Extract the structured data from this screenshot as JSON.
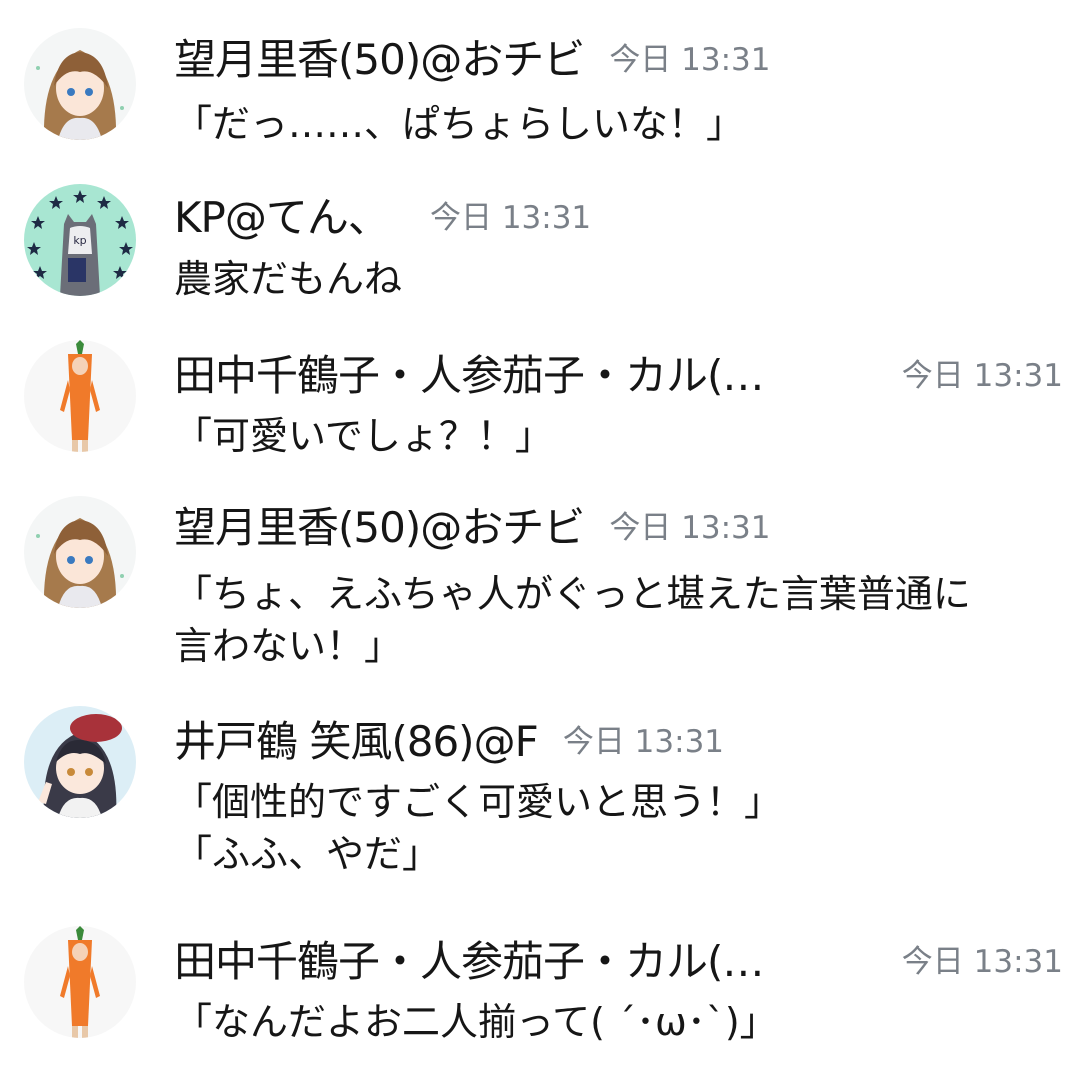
{
  "messages": [
    {
      "name": "望月里香(50)@おチビ",
      "time": "今日 13:31",
      "lines": [
        "「だっ……、ぱちょらしいな！」"
      ]
    },
    {
      "name": "KP@てん、",
      "time": "今日 13:31",
      "lines": [
        "農家だもんね"
      ]
    },
    {
      "name": "田中千鶴子・人参茄子・カル(…",
      "time": "今日 13:31",
      "lines": [
        "「可愛いでしょ？！」"
      ]
    },
    {
      "name": "望月里香(50)@おチビ",
      "time": "今日 13:31",
      "lines": [
        "「ちょ、えふちゃ人がぐっと堪えた言葉普通に",
        "言わない！」"
      ]
    },
    {
      "name": "井戸鶴 笑風(86)@F",
      "time": "今日 13:31",
      "lines": [
        "「個性的ですごく可愛いと思う！」",
        "「ふふ、やだ」"
      ]
    },
    {
      "name": "田中千鶴子・人参茄子・カル(…",
      "time": "今日 13:31",
      "lines": [
        "「なんだよお二人揃って( ´･ω･`)」"
      ]
    }
  ],
  "avatars": {
    "girl_brown_hair": "girl-avatar-icon",
    "kp_cat_stars": "kp-avatar-icon",
    "carrot_costume": "carrot-avatar-icon",
    "girl_dark_hair_beret": "girl-beret-avatar-icon"
  },
  "colors": {
    "timestamp": "#7a8088",
    "text": "#161616",
    "kp_background": "#a8e6d2",
    "carrot": "#f07a2a"
  }
}
